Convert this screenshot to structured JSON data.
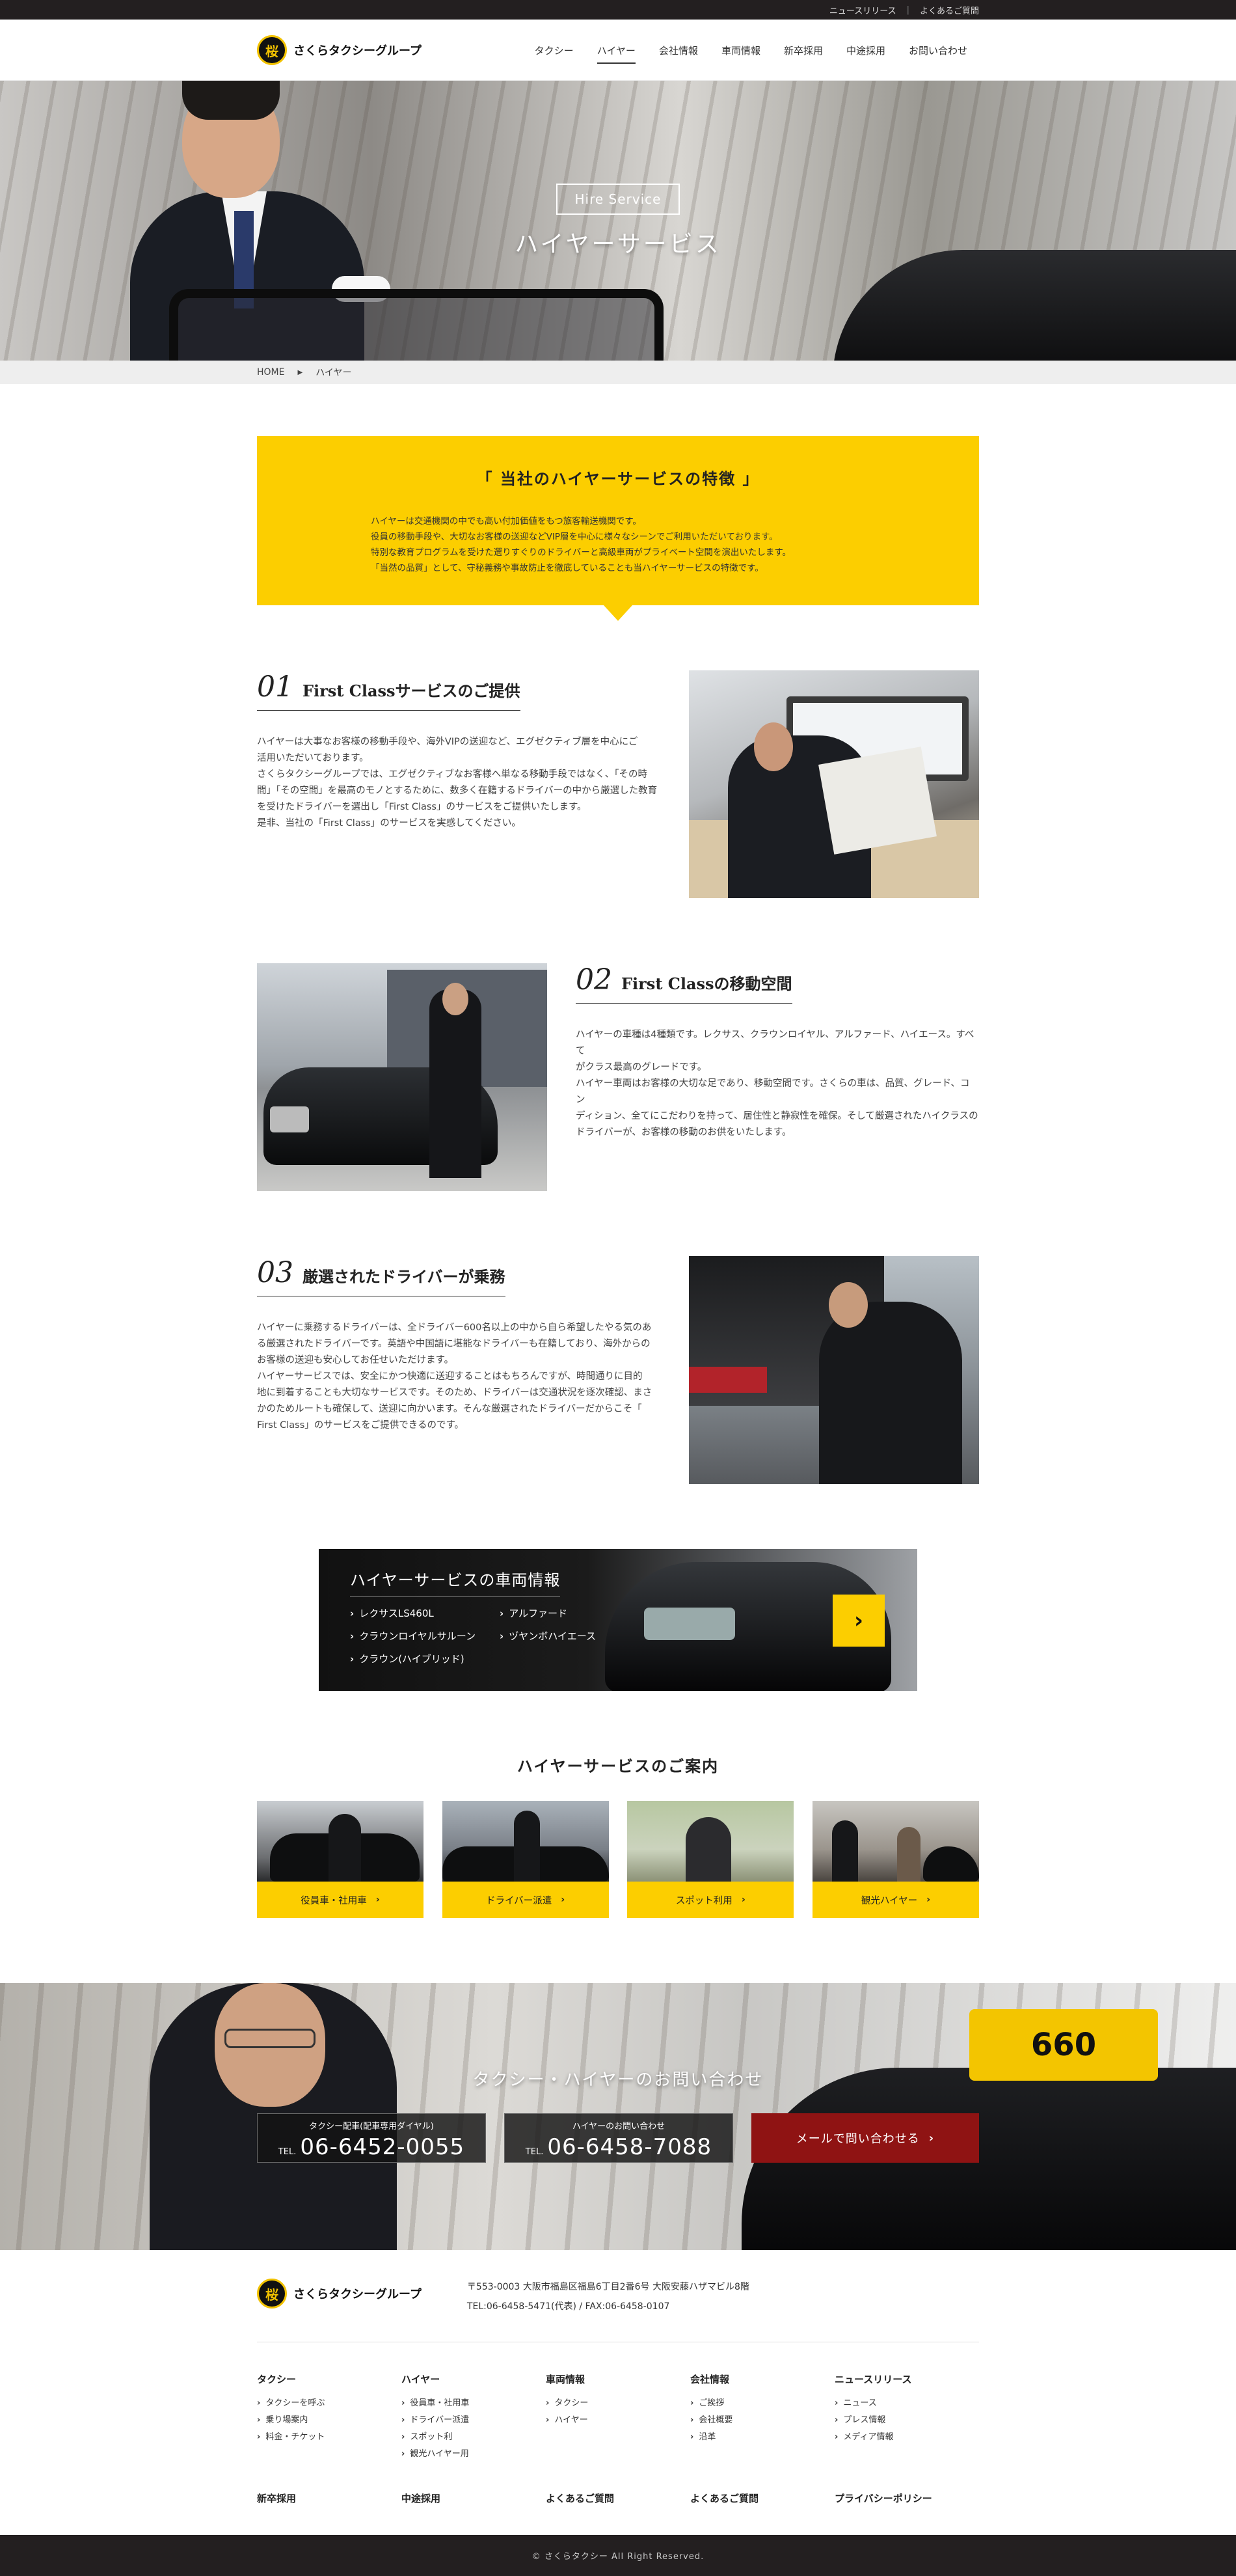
{
  "topbar": {
    "news": "ニュースリリース",
    "faq": "よくあるご質問"
  },
  "header": {
    "logo_text": "さくらタクシーグループ",
    "nav": [
      "タクシー",
      "ハイヤー",
      "会社情報",
      "車両情報",
      "新卒採用",
      "中途採用",
      "お問い合わせ"
    ],
    "active_nav": "ハイヤー"
  },
  "hero": {
    "badge": "Hire Service",
    "title": "ハイヤーサービス"
  },
  "breadcrumb": {
    "home": "HOME",
    "current": "ハイヤー"
  },
  "intro": {
    "title": "「 当社のハイヤーサービスの特徴 」",
    "lines": [
      "ハイヤーは交通機関の中でも高い付加価値をもつ旅客輸送機関です。",
      "役員の移動手段や、大切なお客様の送迎などVIP層を中心に様々なシーンでご利用いただいております。",
      "特別な教育プログラムを受けた選りすぐりのドライバーと高級車両がプライベート空間を演出いたします。",
      "「当然の品質」として、守秘義務や事故防止を徹底していることも当ハイヤーサービスの特徴です。"
    ]
  },
  "features": [
    {
      "num": "01",
      "title": "First Classサービスのご提供",
      "lines": [
        "ハイヤーは大事なお客様の移動手段や、海外VIPの送迎など、エグゼクティブ層を中心にご",
        "活用いただいております。",
        "さくらタクシーグループでは、エグゼクティブなお客様へ単なる移動手段ではなく、「その時",
        "間」「その空間」を最高のモノとするために、数多く在籍するドライバーの中から厳選した教育",
        "を受けたドライバーを選出し「First Class」のサービスをご提供いたします。",
        "是非、当社の「First Class」のサービスを実感してください。"
      ]
    },
    {
      "num": "02",
      "title": "First Classの移動空間",
      "lines": [
        "ハイヤーの車種は4種類です。レクサス、クラウンロイヤル、アルファード、ハイエース。すべて",
        "がクラス最高のグレードです。",
        "ハイヤー車両はお客様の大切な足であり、移動空間です。さくらの車は、品質、グレード、コン",
        "ディション、全てにこだわりを持って、居住性と静寂性を確保。そして厳選されたハイクラスの",
        "ドライバーが、お客様の移動のお供をいたします。"
      ]
    },
    {
      "num": "03",
      "title": "厳選されたドライバーが乗務",
      "lines": [
        "ハイヤーに乗務するドライバーは、全ドライバー600名以上の中から自ら希望したやる気のあ",
        "る厳選されたドライバーです。英語や中国語に堪能なドライバーも在籍しており、海外からの",
        "お客様の送迎も安心してお任せいただけます。",
        "ハイヤーサービスでは、安全にかつ快適に送迎することはもちろんですが、時間通りに目的",
        "地に到着することも大切なサービスです。そのため、ドライバーは交通状況を逐次確認、まさ",
        "かのためルートも確保して、送迎に向かいます。そんな厳選されたドライバーだからこそ「",
        "First Class」のサービスをご提供できるのです。"
      ]
    }
  ],
  "vehicles": {
    "title": "ハイヤーサービスの車両情報",
    "items": [
      "レクサスLS460L",
      "アルファード",
      "クラウンロイヤルサルーン",
      "ヅヤンボハイエース",
      "クラウン(ハイブリッド)"
    ],
    "arrow": "›"
  },
  "guide": {
    "title": "ハイヤーサービスのご案内",
    "cards": [
      "役員車・社用車",
      "ドライバー派遣",
      "スポット利用",
      "観光ハイヤー"
    ]
  },
  "contact": {
    "sign": "660",
    "heading": "タクシー・ハイヤーのお問い合わせ",
    "taxi_caption": "タクシー配車(配車専用ダイヤル)",
    "taxi_tel_prefix": "TEL.",
    "taxi_tel": "06-6452-0055",
    "hire_caption": "ハイヤーのお問い合わせ",
    "hire_tel_prefix": "TEL.",
    "hire_tel": "06-6458-7088",
    "mail": "メールで問い合わせる"
  },
  "footer": {
    "logo_text": "さくらタクシーグループ",
    "address": "〒553-0003 大阪市福島区福島6丁目2番6号 大阪安藤ハザマビル8階",
    "phone": "TEL:06-6458-5471(代表) / FAX:06-6458-0107",
    "cols": [
      {
        "title": "タクシー",
        "items": [
          "タクシーを呼ぶ",
          "乗り場案内",
          "料金・チケット"
        ]
      },
      {
        "title": "ハイヤー",
        "items": [
          "役員車・社用車",
          "ドライバー派遣",
          "スポット利",
          "観光ハイヤー用"
        ]
      },
      {
        "title": "車両情報",
        "items": [
          "タクシー",
          "ハイヤー"
        ]
      },
      {
        "title": "会社情報",
        "items": [
          "ご挨拶",
          "会社概要",
          "沿革"
        ]
      },
      {
        "title": "ニュースリリース",
        "items": [
          "ニュース",
          "プレス情報",
          "メディア情報"
        ]
      }
    ],
    "links": [
      "新卒採用",
      "中途採用",
      "よくあるご質問",
      "よくあるご質問",
      "プライバシーポリシー"
    ],
    "copyright": "© さくらタクシー All Right Reserved."
  }
}
